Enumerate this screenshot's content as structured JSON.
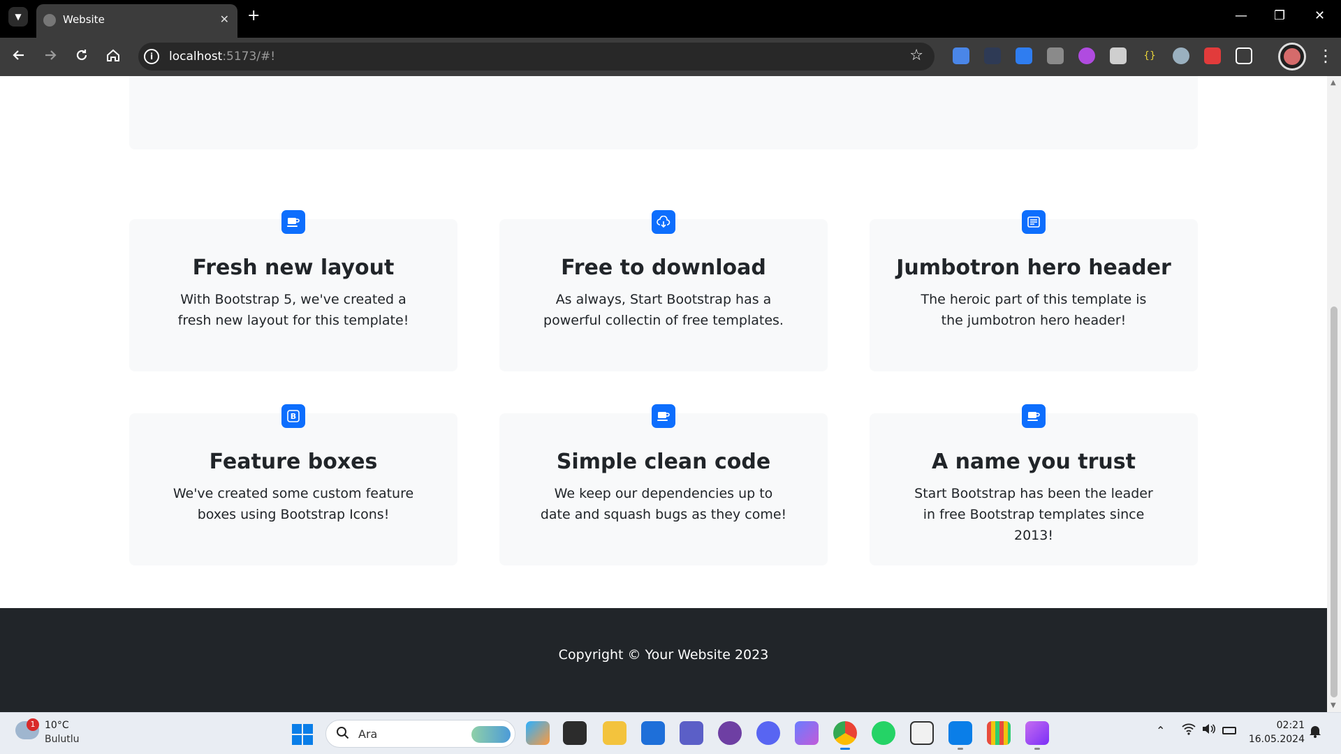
{
  "browser": {
    "tab_title": "Website",
    "tab_close": "✕",
    "new_tab": "+",
    "url_host": "localhost",
    "url_rest": ":5173/#!",
    "info": "i",
    "window_controls": {
      "minimize": "—",
      "restore": "❐",
      "close": "✕"
    },
    "extensions": [
      "translate-icon",
      "pen-icon",
      "document-icon",
      "puzzle-person-icon",
      "brain-icon",
      "glasses-icon",
      "braces-icon",
      "spy-icon",
      "cube-icon",
      "extensions-icon"
    ]
  },
  "features": [
    {
      "icon": "cup-icon",
      "title": "Fresh new layout",
      "text": "With Bootstrap 5, we've created a fresh new layout for this template!"
    },
    {
      "icon": "cloud-download-icon",
      "title": "Free to download",
      "text": "As always, Start Bootstrap has a powerful collectin of free templates."
    },
    {
      "icon": "card-text-icon",
      "title": "Jumbotron hero header",
      "text": "The heroic part of this template is the jumbotron hero header!"
    },
    {
      "icon": "bootstrap-icon",
      "title": "Feature boxes",
      "text": "We've created some custom feature boxes using Bootstrap Icons!"
    },
    {
      "icon": "code-icon",
      "title": "Simple clean code",
      "text": "We keep our dependencies up to date and squash bugs as they come!"
    },
    {
      "icon": "patch-check-icon",
      "title": "A name you trust",
      "text": "Start Bootstrap has been the leader in free Bootstrap templates since 2013!"
    }
  ],
  "footer": {
    "copyright": "Copyright © Your Website 2023"
  },
  "colors": {
    "primary": "#0d6efd",
    "footer_bg": "#212529",
    "card_bg": "#f8f9fa"
  },
  "taskbar": {
    "weather_temp": "10°C",
    "weather_desc": "Bulutlu",
    "weather_badge": "1",
    "search_placeholder": "Ara",
    "time": "02:21",
    "date": "16.05.2024",
    "apps": [
      "copilot-icon",
      "terminal-icon",
      "file-explorer-icon",
      "store-icon",
      "teams-icon",
      "github-icon",
      "discord-icon",
      "copilot-app-icon",
      "chrome-icon",
      "whatsapp-icon",
      "typora-icon",
      "vscode-icon",
      "grid-app-icon",
      "screen-recorder-icon"
    ]
  }
}
